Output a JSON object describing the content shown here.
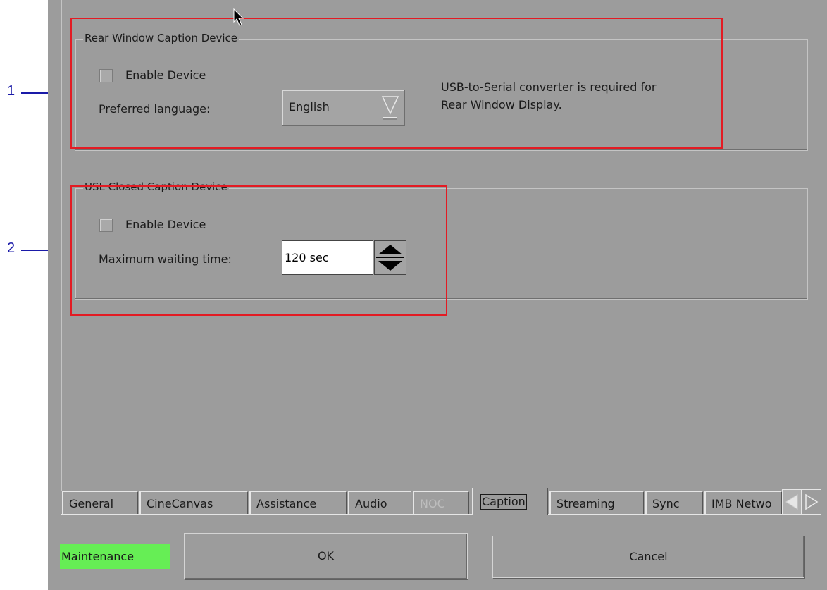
{
  "rear_window": {
    "legend": "Rear Window Caption Device",
    "enable_label": "Enable Device",
    "language_label": "Preferred language:",
    "language_value": "English",
    "note_line1": "USB-to-Serial converter is required for",
    "note_line2": "Rear Window Display."
  },
  "usl": {
    "legend": "USL Closed Caption Device",
    "enable_label": "Enable Device",
    "wait_label": "Maximum waiting time:",
    "wait_value": "120 sec"
  },
  "tabs": [
    {
      "label": "General",
      "state": "normal"
    },
    {
      "label": "CineCanvas",
      "state": "normal"
    },
    {
      "label": "Assistance",
      "state": "normal"
    },
    {
      "label": "Audio",
      "state": "normal"
    },
    {
      "label": "NOC",
      "state": "disabled"
    },
    {
      "label": "Caption",
      "state": "selected"
    },
    {
      "label": "Streaming",
      "state": "normal"
    },
    {
      "label": "Sync",
      "state": "normal"
    },
    {
      "label": "IMB Netwo",
      "state": "normal"
    }
  ],
  "footer": {
    "status": "Maintenance",
    "ok_label": "OK",
    "cancel_label": "Cancel"
  },
  "callouts": {
    "one": "1",
    "two": "2"
  },
  "colors": {
    "background": "#9c9c9c",
    "status_green": "#66ee55",
    "annotation_red": "#e31b23",
    "callout_blue": "#1a1aa8"
  },
  "icons": {
    "cursor": "mouse-pointer-icon",
    "dropdown": "triangle-down-icon",
    "spin_up": "triangle-up-icon",
    "spin_down": "triangle-down-icon",
    "tab_left": "arrow-left-icon",
    "tab_right": "arrow-right-icon"
  }
}
